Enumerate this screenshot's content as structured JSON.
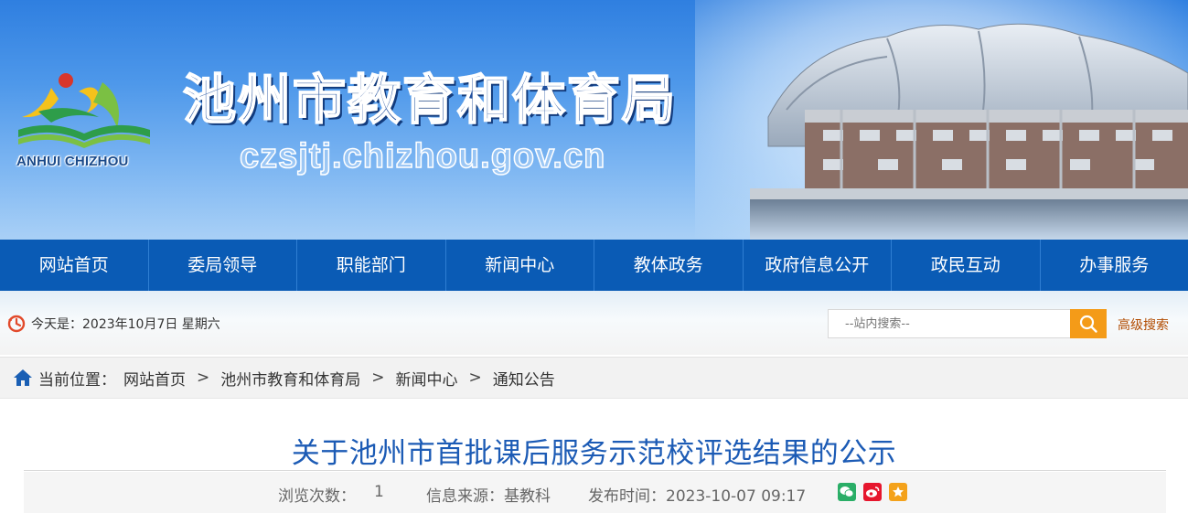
{
  "header": {
    "title": "池州市教育和体育局",
    "url": "czsjtj.chizhou.gov.cn",
    "logo_text": "ANHUI CHIZHOU"
  },
  "nav": {
    "items": [
      {
        "label": "网站首页"
      },
      {
        "label": "委局领导"
      },
      {
        "label": "职能部门"
      },
      {
        "label": "新闻中心"
      },
      {
        "label": "教体政务"
      },
      {
        "label": "政府信息公开"
      },
      {
        "label": "政民互动"
      },
      {
        "label": "办事服务"
      }
    ]
  },
  "infobar": {
    "date_text": "今天是：2023年10月7日 星期六",
    "search_placeholder": "--站内搜索--",
    "advanced_search": "高级搜索"
  },
  "breadcrumb": {
    "label": "当前位置：",
    "items": [
      "网站首页",
      "池州市教育和体育局",
      "新闻中心",
      "通知公告"
    ],
    "separator": ">"
  },
  "article": {
    "title": "关于池州市首批课后服务示范校评选结果的公示",
    "views_label": "浏览次数：",
    "views_value": "1",
    "source": "信息来源：基教科",
    "published": "发布时间：2023-10-07 09:17"
  },
  "icons": {
    "clock": "clock-icon",
    "search": "search-icon",
    "home": "home-icon",
    "wechat": "wechat-icon",
    "weibo": "weibo-icon",
    "favorite": "star-icon"
  },
  "colors": {
    "nav_bg": "#0a5bb5",
    "title_blue": "#1c5bb5",
    "search_orange": "#f49b18",
    "wechat_green": "#2aae67",
    "weibo_red": "#e6162d",
    "star_orange": "#f4a21b"
  }
}
